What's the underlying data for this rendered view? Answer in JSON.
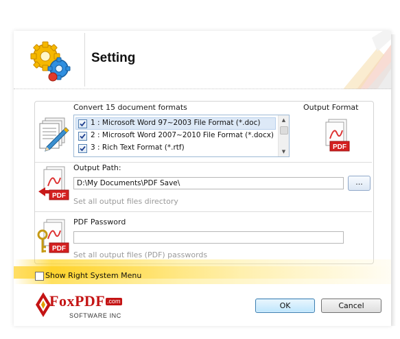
{
  "header": {
    "title": "Setting"
  },
  "formats": {
    "title": "Convert 15 document formats",
    "items": [
      {
        "label": "1 : Microsoft Word 97~2003 File Format (*.doc)",
        "checked": true,
        "selected": true
      },
      {
        "label": "2 : Microsoft Word 2007~2010 File Format (*.docx)",
        "checked": true,
        "selected": false
      },
      {
        "label": "3 : Rich Text Format (*.rtf)",
        "checked": true,
        "selected": false
      }
    ]
  },
  "output_format": {
    "label": "Output Format",
    "badge": "PDF"
  },
  "output_path": {
    "label": "Output Path:",
    "value": "D:\\My Documents\\PDF Save\\",
    "browse_label": "...",
    "hint": "Set all output files directory",
    "badge": "PDF"
  },
  "pdf_password": {
    "label": "PDF Password",
    "value": "",
    "hint": "Set all output files (PDF) passwords",
    "badge": "PDF"
  },
  "show_menu": {
    "label": "Show Right System Menu",
    "checked": false
  },
  "footer": {
    "logo_main": "FoxPDF",
    "logo_com": ".com",
    "logo_sub": "SOFTWARE INC",
    "ok_label": "OK",
    "cancel_label": "Cancel"
  },
  "colors": {
    "accent": "#c41414",
    "band": "#ffd628",
    "selection": "#dde9f7"
  },
  "icons": [
    "gears-icon",
    "document-pen-icon",
    "pdf-icon",
    "pdf-arrow-icon",
    "pdf-key-icon"
  ]
}
